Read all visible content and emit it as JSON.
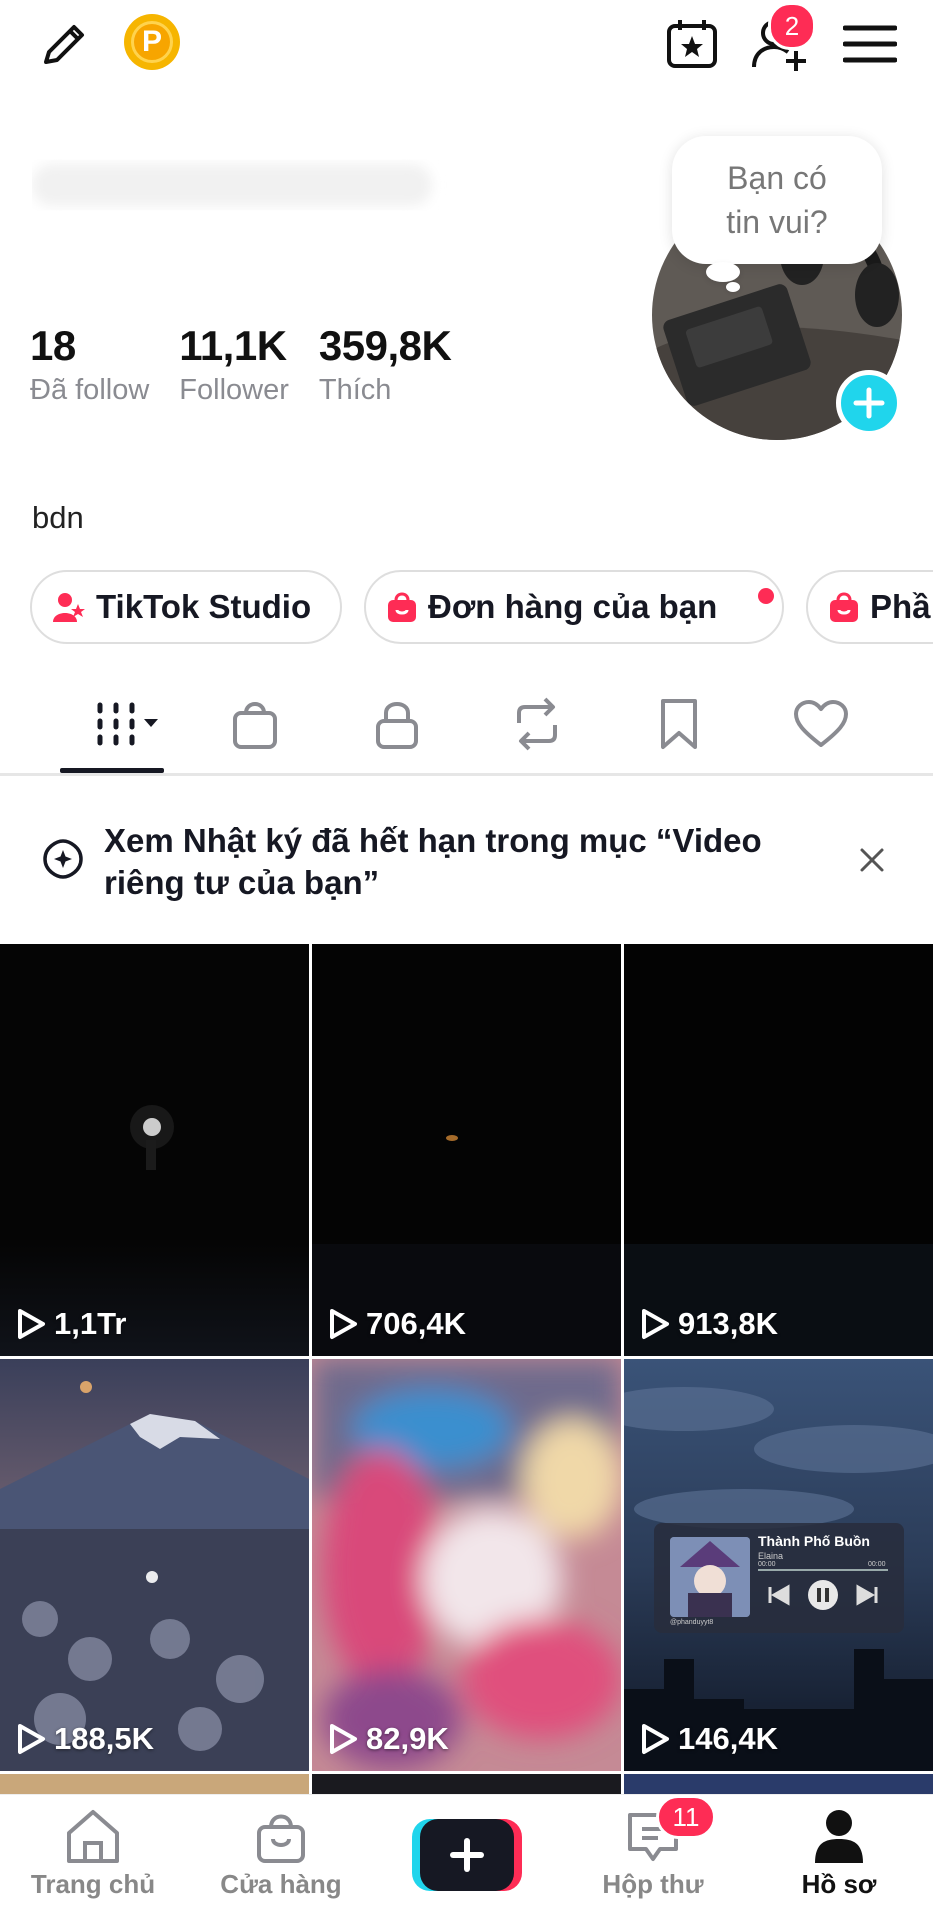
{
  "topbar": {
    "coin_letter": "P",
    "friends_badge": "2"
  },
  "bubble": {
    "line1": "Bạn có",
    "line2": "tin vui?"
  },
  "stats": [
    {
      "value": "18",
      "label": "Đã follow"
    },
    {
      "value": "11,1K",
      "label": "Follower"
    },
    {
      "value": "359,8K",
      "label": "Thích"
    }
  ],
  "bio": "bdn",
  "chips": [
    {
      "label": "TikTok Studio"
    },
    {
      "label": "Đơn hàng của bạn"
    },
    {
      "label": "Phầ"
    }
  ],
  "notice": {
    "text": "Xem Nhật ký đã hết hạn trong mục “Video riêng tư của bạn”"
  },
  "videos": [
    {
      "views": "1,1Tr"
    },
    {
      "views": "706,4K"
    },
    {
      "views": "913,8K"
    },
    {
      "views": "188,5K"
    },
    {
      "views": "82,9K"
    },
    {
      "views": "146,4K"
    }
  ],
  "music_card": {
    "title": "Thành Phố Buồn",
    "artist": "Elaina",
    "t0": "00:00",
    "t1": "00:00",
    "handle": "@phanduyyt8"
  },
  "nav": {
    "home": "Trang chủ",
    "shop": "Cửa hàng",
    "inbox": "Hộp thư",
    "inbox_badge": "11",
    "profile": "Hồ sơ"
  },
  "colors": {
    "accent_red": "#fe2c55",
    "accent_cyan": "#20d5ec",
    "coin": "#f6b500"
  }
}
